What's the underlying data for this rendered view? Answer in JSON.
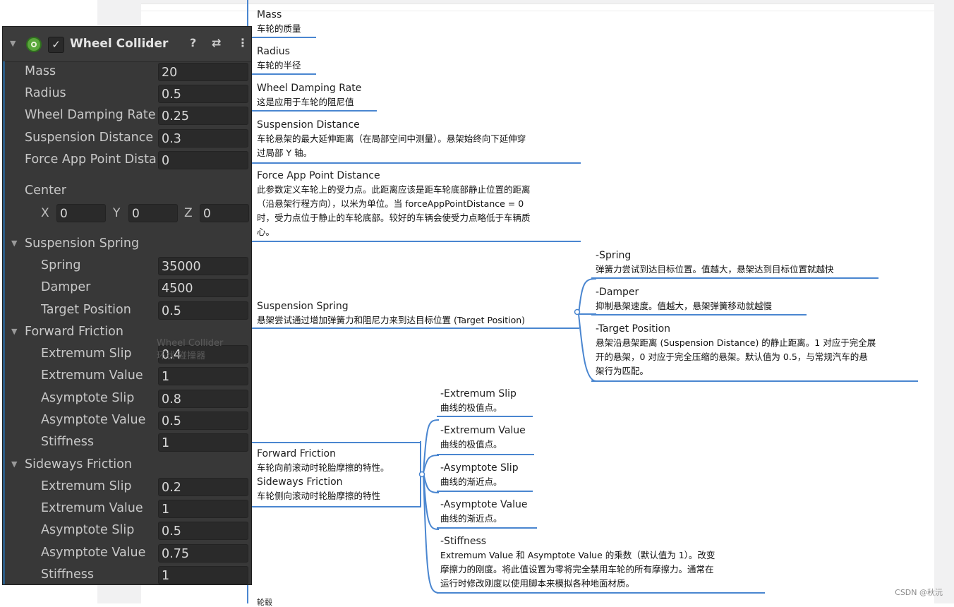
{
  "inspector": {
    "component_name": "Wheel Collider",
    "enabled_mark": "✓",
    "header_icons": [
      "help-icon",
      "preset-icon",
      "more-vert-icon"
    ],
    "fields": [
      {
        "label": "Mass",
        "value": "20"
      },
      {
        "label": "Radius",
        "value": "0.5"
      },
      {
        "label": "Wheel Damping Rate",
        "value": "0.25"
      },
      {
        "label": "Suspension Distance",
        "value": "0.3"
      },
      {
        "label": "Force App Point Distance",
        "value": "0"
      }
    ],
    "center": {
      "label": "Center",
      "x_label": "X",
      "x": "0",
      "y_label": "Y",
      "y": "0",
      "z_label": "Z",
      "z": "0"
    },
    "suspension_spring": {
      "label": "Suspension Spring",
      "fields": [
        {
          "label": "Spring",
          "value": "35000"
        },
        {
          "label": "Damper",
          "value": "4500"
        },
        {
          "label": "Target Position",
          "value": "0.5"
        }
      ]
    },
    "forward_friction": {
      "label": "Forward Friction",
      "fields": [
        {
          "label": "Extremum Slip",
          "value": "0.4"
        },
        {
          "label": "Extremum Value",
          "value": "1"
        },
        {
          "label": "Asymptote Slip",
          "value": "0.8"
        },
        {
          "label": "Asymptote Value",
          "value": "0.5"
        },
        {
          "label": "Stiffness",
          "value": "1"
        }
      ]
    },
    "sideways_friction": {
      "label": "Sideways Friction",
      "fields": [
        {
          "label": "Extremum Slip",
          "value": "0.2"
        },
        {
          "label": "Extremum Value",
          "value": "1"
        },
        {
          "label": "Asymptote Slip",
          "value": "0.5"
        },
        {
          "label": "Asymptote Value",
          "value": "0.75"
        },
        {
          "label": "Stiffness",
          "value": "1"
        }
      ]
    }
  },
  "mindmap": {
    "mass": {
      "title": "Mass",
      "desc": "车轮的质量"
    },
    "radius": {
      "title": "Radius",
      "desc": "车轮的半径"
    },
    "damping": {
      "title": "Wheel Damping Rate",
      "desc": "这是应用于车轮的阻尼值"
    },
    "suspension_distance": {
      "title": "Suspension Distance",
      "desc1": "车轮悬架的最大延伸距离（在局部空间中测量）。悬架始终向下延伸穿",
      "desc2": "过局部 Y 轴。"
    },
    "force_app": {
      "title": "Force App Point Distance",
      "desc1": "此参数定义车轮上的受力点。此距离应该是距车轮底部静止位置的距离",
      "desc2": "（沿悬架行程方向），以米为单位。当 forceAppPointDistance = 0",
      "desc3": "时，受力点位于静止的车轮底部。较好的车辆会使受力点略低于车辆质",
      "desc4": "心。"
    },
    "suspension_spring": {
      "title": "Suspension Spring",
      "desc": "悬架尝试通过增加弹簧力和阻尼力来到达目标位置 (Target Position)"
    },
    "spring": {
      "title": "-Spring",
      "desc": "弹簧力尝试到达目标位置。值越大，悬架达到目标位置就越快"
    },
    "damper": {
      "title": "-Damper",
      "desc": "抑制悬架速度。值越大，悬架弹簧移动就越慢"
    },
    "target": {
      "title": "-Target Position",
      "desc1": "悬架沿悬架距离 (Suspension Distance) 的静止距离。1 对应于完全展",
      "desc2": "开的悬架，0 对应于完全压缩的悬架。默认值为 0.5，与常规汽车的悬",
      "desc3": "架行为匹配。"
    },
    "friction": {
      "title1": "Forward Friction",
      "desc1": "车轮向前滚动时轮胎摩擦的特性。",
      "title2": "Sideways Friction",
      "desc2": "车轮侧向滚动时轮胎摩擦的特性"
    },
    "ext_slip": {
      "title": "-Extremum Slip",
      "desc": "曲线的极值点。"
    },
    "ext_value": {
      "title": "-Extremum Value",
      "desc": "曲线的极值点。"
    },
    "asy_slip": {
      "title": "-Asymptote Slip",
      "desc": "曲线的渐近点。"
    },
    "asy_value": {
      "title": "-Asymptote Value",
      "desc": "曲线的渐近点。"
    },
    "stiffness": {
      "title": "-Stiffness",
      "desc1": "Extremum Value 和 Asymptote Value 的乘数（默认值为 1）。改变",
      "desc2": "摩擦力的刚度。将此值设置为零将完全禁用车轮的所有摩擦力。通常在",
      "desc3": "运行时修改刚度以使用脚本来模拟各种地面材质。"
    },
    "ghost": {
      "line1": "Wheel Collider",
      "line2": "环状 碰撞器"
    },
    "bottom_partial": "轮毂"
  },
  "watermark": "CSDN @秋沅",
  "colors": {
    "line": "#4a86d0",
    "inspector_bg": "#383838",
    "field_bg": "#2a2a2a"
  }
}
